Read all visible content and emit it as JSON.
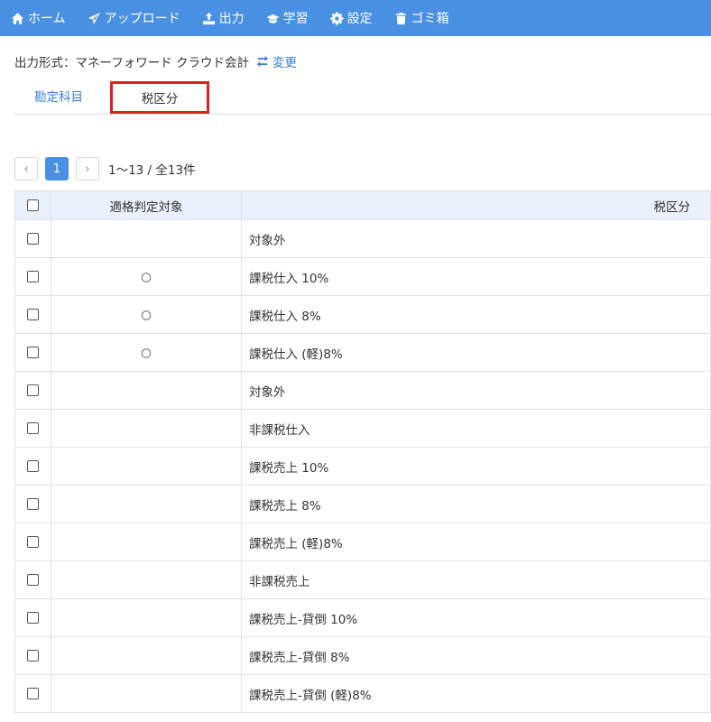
{
  "nav": {
    "items": [
      {
        "label": "ホーム",
        "icon": "home-icon"
      },
      {
        "label": "アップロード",
        "icon": "send-icon"
      },
      {
        "label": "出力",
        "icon": "output-icon"
      },
      {
        "label": "学習",
        "icon": "graduation-cap-icon"
      },
      {
        "label": "設定",
        "icon": "gear-icon"
      },
      {
        "label": "ゴミ箱",
        "icon": "trash-icon"
      }
    ]
  },
  "format": {
    "label": "出力形式：マネーフォワード クラウド会計",
    "change_label": "変更"
  },
  "tabs": {
    "accounts": "勘定科目",
    "tax": "税区分"
  },
  "pager": {
    "prev": "‹",
    "current": "1",
    "next": "›",
    "info": "1〜13 / 全13件"
  },
  "table": {
    "headers": {
      "eligibility": "適格判定対象",
      "tax_category": "税区分"
    },
    "rows": [
      {
        "eligible": "",
        "tax": "対象外"
      },
      {
        "eligible": "○",
        "tax": "課税仕入 10%"
      },
      {
        "eligible": "○",
        "tax": "課税仕入 8%"
      },
      {
        "eligible": "○",
        "tax": "課税仕入 (軽)8%"
      },
      {
        "eligible": "",
        "tax": "対象外"
      },
      {
        "eligible": "",
        "tax": "非課税仕入"
      },
      {
        "eligible": "",
        "tax": "課税売上 10%"
      },
      {
        "eligible": "",
        "tax": "課税売上 8%"
      },
      {
        "eligible": "",
        "tax": "課税売上 (軽)8%"
      },
      {
        "eligible": "",
        "tax": "非課税売上"
      },
      {
        "eligible": "",
        "tax": "課税売上-貸倒 10%"
      },
      {
        "eligible": "",
        "tax": "課税売上-貸倒 8%"
      },
      {
        "eligible": "",
        "tax": "課税売上-貸倒 (軽)8%"
      }
    ]
  }
}
